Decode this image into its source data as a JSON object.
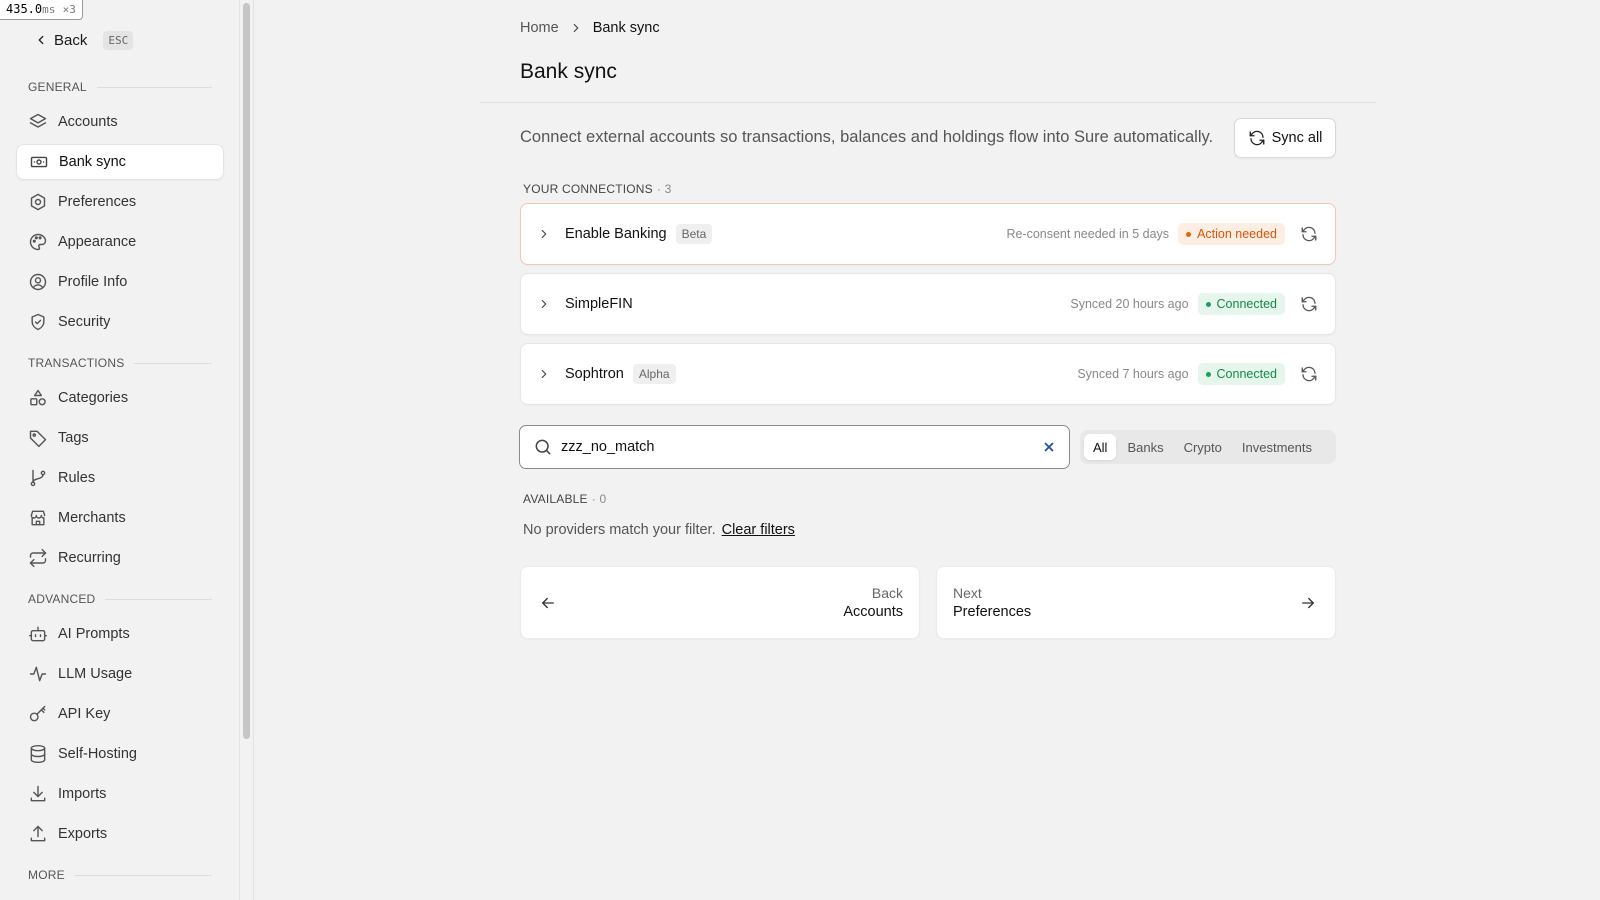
{
  "perf_overlay": {
    "value": "435.0",
    "unit": "ms",
    "multiplier": "×3"
  },
  "sidebar": {
    "back_label": "Back",
    "back_shortcut": "ESC",
    "sections": {
      "general": "GENERAL",
      "transactions": "TRANSACTIONS",
      "advanced": "ADVANCED",
      "more": "MORE"
    },
    "items": {
      "accounts": "Accounts",
      "bank_sync": "Bank sync",
      "preferences": "Preferences",
      "appearance": "Appearance",
      "profile_info": "Profile Info",
      "security": "Security",
      "categories": "Categories",
      "tags": "Tags",
      "rules": "Rules",
      "merchants": "Merchants",
      "recurring": "Recurring",
      "ai_prompts": "AI Prompts",
      "llm_usage": "LLM Usage",
      "api_key": "API Key",
      "self_hosting": "Self-Hosting",
      "imports": "Imports",
      "exports": "Exports"
    },
    "active_item": "bank_sync"
  },
  "breadcrumb": {
    "home": "Home",
    "current": "Bank sync"
  },
  "page": {
    "title": "Bank sync",
    "intro": "Connect external accounts so transactions, balances and holdings flow into Sure automatically.",
    "sync_all_label": "Sync all"
  },
  "connections": {
    "label": "YOUR CONNECTIONS",
    "count": "· 3",
    "items": [
      {
        "name": "Enable Banking",
        "tag": "Beta",
        "meta": "Re-consent needed in 5 days",
        "status": "Action needed",
        "status_kind": "warn"
      },
      {
        "name": "SimpleFIN",
        "tag": "",
        "meta": "Synced 20 hours ago",
        "status": "Connected",
        "status_kind": "ok"
      },
      {
        "name": "Sophtron",
        "tag": "Alpha",
        "meta": "Synced 7 hours ago",
        "status": "Connected",
        "status_kind": "ok"
      }
    ]
  },
  "search": {
    "value": "zzz_no_match",
    "placeholder": ""
  },
  "filters": {
    "tabs": [
      "All",
      "Banks",
      "Crypto",
      "Investments"
    ],
    "active": "All"
  },
  "available": {
    "label": "AVAILABLE",
    "count": "· 0",
    "empty_message": "No providers match your filter.",
    "clear_filters": "Clear filters"
  },
  "pager": {
    "prev_small": "Back",
    "prev_big": "Accounts",
    "next_small": "Next",
    "next_big": "Preferences"
  },
  "colors": {
    "warn_text": "#d5560b",
    "warn_bg": "#fdeee4",
    "ok_text": "#14894a",
    "ok_bg": "#e6f6ec",
    "clear_x": "#1d4fa8"
  }
}
